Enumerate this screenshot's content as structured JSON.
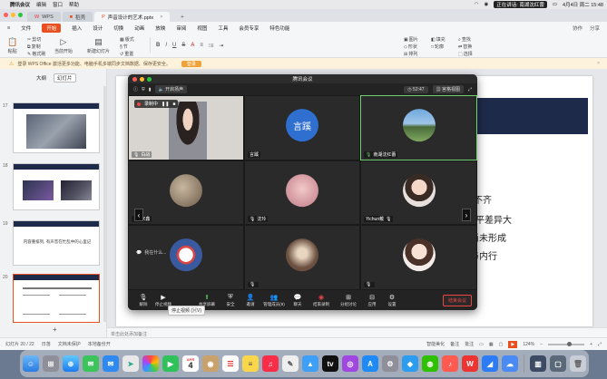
{
  "menubar": {
    "app_name": "腾讯会议",
    "items": [
      "编辑",
      "窗口",
      "帮助"
    ],
    "sharing_label": "正在讲话: 南湖沈红蕾",
    "datetime": "4月4日 周二 15:48"
  },
  "browser_tabs": [
    {
      "label": "WPS",
      "active": false
    },
    {
      "label": "稻壳",
      "active": false
    },
    {
      "label": "声音设计的艺术.pptx",
      "active": true
    }
  ],
  "ribbon_tabs": {
    "items": [
      "文件",
      "开始",
      "插入",
      "设计",
      "切换",
      "动画",
      "放映",
      "审阅",
      "视图",
      "工具",
      "会员专享",
      "特色功能"
    ],
    "active": "开始",
    "right_items": [
      "协作",
      "分享"
    ]
  },
  "ribbon_buttons": {
    "paste": "粘贴",
    "cut": "剪切",
    "copy": "复制",
    "format_painter": "格式刷",
    "from_current": "当前开始",
    "new_slide": "新建幻灯片",
    "layout": "版式",
    "section": "节",
    "reset": "重置",
    "picture": "图片",
    "fill": "填充",
    "find": "查找",
    "replace": "替换",
    "shape": "形状",
    "outline": "轮廓",
    "select": "选择",
    "arrange": "排列"
  },
  "notice": {
    "text": "登录 WPS Office 激活更多功能、电脑手机多端同步文档数据、保存更安全。",
    "button": "登录"
  },
  "left_panel": {
    "tabs": [
      "大纲",
      "幻灯片"
    ],
    "active_tab": "幻灯片",
    "slide_numbers": [
      "17",
      "18",
      "19",
      "20"
    ],
    "slide19_text": "内容重排列, 有声音在忙乱中的心里记",
    "add_label": "+"
  },
  "slide": {
    "lines": [
      "不齐",
      "水平差异大",
      "尚未形成",
      "与内行"
    ]
  },
  "notes_placeholder": "单击此处添加备注",
  "statusbar": {
    "slide_count": "幻灯片 20 / 22",
    "theme": "日落",
    "backup": "文档未保护",
    "local_backup": "本地备份开",
    "smart_beautify": "智能美化",
    "notes": "备注",
    "comment": "批注",
    "zoom": "124%",
    "zoom_fraction": 0.6
  },
  "meeting": {
    "title": "腾讯会议",
    "speaker_button": "开启扬声",
    "timer": "52:47",
    "view_button": "宫格视图",
    "record_label": "录制中",
    "tiles": [
      {
        "name": "白战",
        "type": "video",
        "active": false
      },
      {
        "name": "言蹊",
        "type": "text",
        "initials": "言蹊",
        "active": false
      },
      {
        "name": "南湖沈红蕾",
        "type": "photo",
        "active": true
      },
      {
        "name": "宋鑫",
        "type": "photo",
        "active": false
      },
      {
        "name": "沈玲",
        "type": "photo",
        "active": false
      },
      {
        "name": "Yichun戴",
        "type": "photo",
        "active": false
      },
      {
        "name": "我在什么...",
        "type": "photo",
        "active": false
      },
      {
        "name": "",
        "type": "photo",
        "active": false
      },
      {
        "name": "",
        "type": "photo",
        "active": false
      }
    ],
    "toolbar": [
      {
        "label": "解除",
        "icon": "mic-icon"
      },
      {
        "label": "停止视频",
        "icon": "camera-icon"
      },
      {
        "label": "共享屏幕",
        "icon": "share-screen-icon"
      },
      {
        "label": "安全",
        "icon": "shield-icon"
      },
      {
        "label": "邀请",
        "icon": "invite-icon"
      },
      {
        "label": "管理成员(9)",
        "icon": "members-icon"
      },
      {
        "label": "聊天",
        "icon": "chat-icon"
      },
      {
        "label": "结束录制",
        "icon": "record-icon"
      },
      {
        "label": "分组讨论",
        "icon": "breakout-icon"
      },
      {
        "label": "应用",
        "icon": "apps-icon"
      },
      {
        "label": "设置",
        "icon": "gear-icon"
      }
    ],
    "end_button": "结束会议",
    "tooltip": "停止视频 (⌘V)"
  },
  "dock": {
    "calendar_day": "4",
    "calendar_month": "APR"
  },
  "colors": {
    "accent": "#e94f1f",
    "navy": "#1e2a4a",
    "meeting_bg": "#1c1c1c",
    "active_speaker": "#6fd16f"
  }
}
